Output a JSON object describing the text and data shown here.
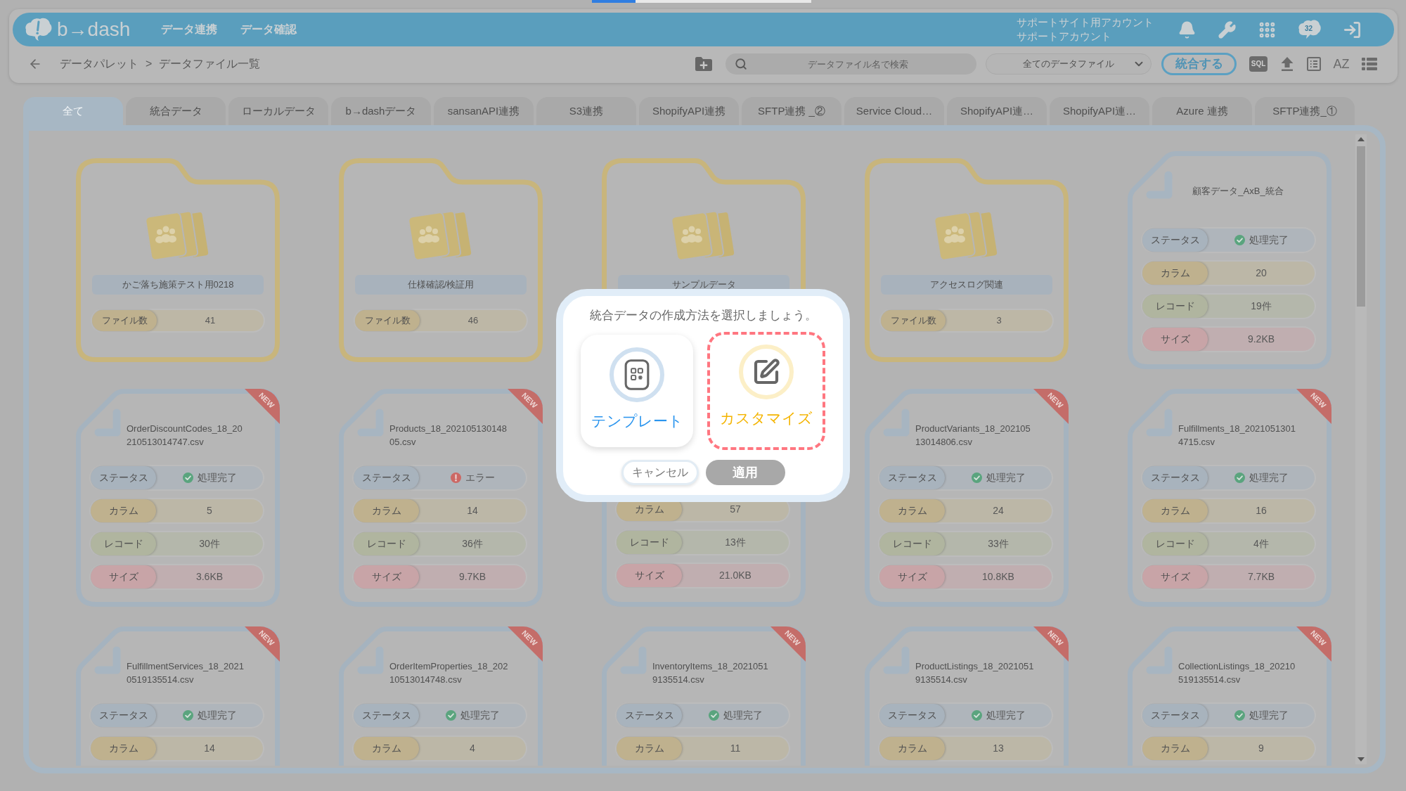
{
  "loading_bar": {
    "level": 0.2
  },
  "header": {
    "logo": "b→dash",
    "nav": [
      "データ連携",
      "データ確認"
    ],
    "account": [
      "サポートサイト用アカウント",
      "サポートアカウント"
    ],
    "icons": [
      {
        "kind": "bell"
      },
      {
        "kind": "wrench"
      },
      {
        "kind": "apps"
      },
      {
        "kind": "chat",
        "badge": "32"
      },
      {
        "kind": "exit"
      }
    ]
  },
  "toolbar": {
    "breadcrumb": [
      "データパレット",
      "データファイル一覧"
    ],
    "separator": ">",
    "search": {
      "placeholder": "データファイル名で検索"
    },
    "filter": {
      "value": "全てのデータファイル"
    },
    "merge_button": "統合する",
    "tools": [
      {
        "kind": "sql",
        "label": "SQL"
      },
      {
        "kind": "upload"
      },
      {
        "kind": "table"
      },
      {
        "kind": "sort",
        "label": "AZ"
      },
      {
        "kind": "list"
      }
    ]
  },
  "tabs": [
    {
      "label": "全て",
      "selected": true
    },
    {
      "label": "統合データ",
      "selected": false
    },
    {
      "label": "ローカルデータ",
      "selected": false
    },
    {
      "label": "b→dashデータ",
      "selected": false
    },
    {
      "label": "sansanAPI連携",
      "selected": false
    },
    {
      "label": "S3連携",
      "selected": false
    },
    {
      "label": "ShopifyAPI連携",
      "selected": false
    },
    {
      "label": "SFTP連携 _②",
      "selected": false
    },
    {
      "label": "Service Cloud…",
      "selected": false
    },
    {
      "label": "ShopifyAPI連…",
      "selected": false
    },
    {
      "label": "ShopifyAPI連…",
      "selected": false
    },
    {
      "label": "Azure 連携",
      "selected": false
    },
    {
      "label": "SFTP連携_①",
      "selected": false
    }
  ],
  "items": [
    {
      "kind": "folder",
      "name": "かご落ち施策テスト用0218",
      "count_label": "ファイル数",
      "count": "41"
    },
    {
      "kind": "folder",
      "name": "仕様確認/検証用",
      "count_label": "ファイル数",
      "count": "46"
    },
    {
      "kind": "folder",
      "name": "サンプルデータ"
    },
    {
      "kind": "folder",
      "name": "アクセスログ関連",
      "count_label": "ファイル数",
      "count": "3"
    },
    {
      "kind": "file",
      "name": "顧客データ_AxB_統合",
      "rows": [
        {
          "kind": "status",
          "label": "ステータス",
          "value": "処理完了",
          "ok": true
        },
        {
          "kind": "columns",
          "label": "カラム",
          "value": "20"
        },
        {
          "kind": "records",
          "label": "レコード",
          "value": "19件"
        },
        {
          "kind": "size",
          "label": "サイズ",
          "value": "9.2KB"
        }
      ]
    },
    {
      "kind": "file",
      "name": "OrderDiscountCodes_18_20210513014747.csv",
      "badge": "NEW",
      "rows": [
        {
          "kind": "status",
          "label": "ステータス",
          "value": "処理完了",
          "ok": true
        },
        {
          "kind": "columns",
          "label": "カラム",
          "value": "5"
        },
        {
          "kind": "records",
          "label": "レコード",
          "value": "30件"
        },
        {
          "kind": "size",
          "label": "サイズ",
          "value": "3.6KB"
        }
      ]
    },
    {
      "kind": "file",
      "name": "Products_18_20210513014805.csv",
      "badge": "NEW",
      "rows": [
        {
          "kind": "status",
          "label": "ステータス",
          "value": "エラー",
          "ok": false
        },
        {
          "kind": "columns",
          "label": "カラム",
          "value": "14"
        },
        {
          "kind": "records",
          "label": "レコード",
          "value": "36件"
        },
        {
          "kind": "size",
          "label": "サイズ",
          "value": "9.7KB"
        }
      ]
    },
    {
      "kind": "file",
      "rows": [
        {
          "kind": "columns",
          "label": "カラム",
          "value": "57"
        },
        {
          "kind": "records",
          "label": "レコード",
          "value": "13件"
        },
        {
          "kind": "size",
          "label": "サイズ",
          "value": "21.0KB"
        }
      ]
    },
    {
      "kind": "file",
      "name": "ProductVariants_18_20210513014806.csv",
      "badge": "NEW",
      "rows": [
        {
          "kind": "status",
          "label": "ステータス",
          "value": "処理完了",
          "ok": true
        },
        {
          "kind": "columns",
          "label": "カラム",
          "value": "24"
        },
        {
          "kind": "records",
          "label": "レコード",
          "value": "33件"
        },
        {
          "kind": "size",
          "label": "サイズ",
          "value": "10.8KB"
        }
      ]
    },
    {
      "kind": "file",
      "name": "Fulfillments_18_20210513014715.csv",
      "badge": "NEW",
      "rows": [
        {
          "kind": "status",
          "label": "ステータス",
          "value": "処理完了",
          "ok": true
        },
        {
          "kind": "columns",
          "label": "カラム",
          "value": "16"
        },
        {
          "kind": "records",
          "label": "レコード",
          "value": "4件"
        },
        {
          "kind": "size",
          "label": "サイズ",
          "value": "7.7KB"
        }
      ]
    },
    {
      "kind": "file",
      "name": "FulfillmentServices_18_20210519135514.csv",
      "badge": "NEW",
      "rows": [
        {
          "kind": "status",
          "label": "ステータス",
          "value": "処理完了",
          "ok": true
        },
        {
          "kind": "columns",
          "label": "カラム",
          "value": "14"
        }
      ]
    },
    {
      "kind": "file",
      "name": "OrderItemProperties_18_20210513014748.csv",
      "badge": "NEW",
      "rows": [
        {
          "kind": "status",
          "label": "ステータス",
          "value": "処理完了",
          "ok": true
        },
        {
          "kind": "columns",
          "label": "カラム",
          "value": "4"
        }
      ]
    },
    {
      "kind": "file",
      "name": "InventoryItems_18_20210519135514.csv",
      "badge": "NEW",
      "rows": [
        {
          "kind": "status",
          "label": "ステータス",
          "value": "処理完了",
          "ok": true
        },
        {
          "kind": "columns",
          "label": "カラム",
          "value": "11"
        }
      ]
    },
    {
      "kind": "file",
      "name": "ProductListings_18_20210519135514.csv",
      "badge": "NEW",
      "rows": [
        {
          "kind": "status",
          "label": "ステータス",
          "value": "処理完了",
          "ok": true
        },
        {
          "kind": "columns",
          "label": "カラム",
          "value": "13"
        }
      ]
    },
    {
      "kind": "file",
      "name": "CollectionListings_18_20210519135514.csv",
      "badge": "NEW",
      "rows": [
        {
          "kind": "status",
          "label": "ステータス",
          "value": "処理完了",
          "ok": true
        },
        {
          "kind": "columns",
          "label": "カラム",
          "value": "9"
        }
      ]
    }
  ],
  "modal": {
    "title": "統合データの作成方法を選択しましょう。",
    "options": [
      {
        "kind": "template",
        "label": "テンプレート",
        "selected": false
      },
      {
        "kind": "custom",
        "label": "カスタマイズ",
        "selected": true
      }
    ],
    "buttons": [
      {
        "kind": "cancel",
        "label": "キャンセル",
        "disabled": false
      },
      {
        "kind": "apply",
        "label": "適用",
        "disabled": true
      }
    ]
  }
}
